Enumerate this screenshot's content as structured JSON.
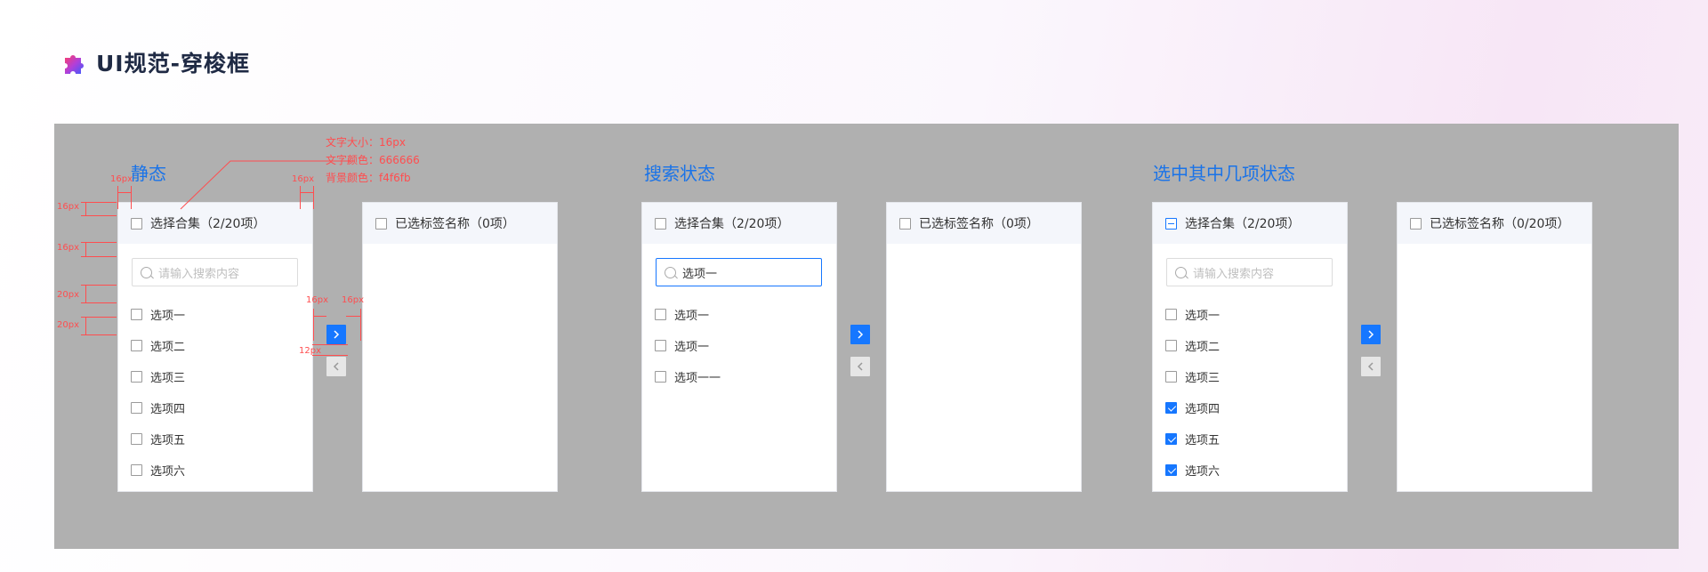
{
  "page": {
    "title": "UI规范-穿梭框",
    "logo_icon": "puzzle-icon",
    "accent_color": "#1677ff",
    "annotation_color": "#ff4d4f"
  },
  "sections": [
    {
      "title": "静态",
      "source": {
        "header": "选择合集（2/20项）",
        "header_state": "unchecked",
        "search_value": "",
        "search_placeholder": "请输入搜索内容",
        "items": [
          {
            "label": "选项一",
            "checked": false
          },
          {
            "label": "选项二",
            "checked": false
          },
          {
            "label": "选项三",
            "checked": false
          },
          {
            "label": "选项四",
            "checked": false
          },
          {
            "label": "选项五",
            "checked": false
          },
          {
            "label": "选项六",
            "checked": false
          }
        ]
      },
      "target": {
        "header": "已选标签名称（0项）",
        "header_state": "unchecked"
      }
    },
    {
      "title": "搜索状态",
      "source": {
        "header": "选择合集（2/20项）",
        "header_state": "unchecked",
        "search_value": "选项一",
        "search_placeholder": "",
        "items": [
          {
            "label": "选项一",
            "checked": false
          },
          {
            "label": "选项一",
            "checked": false
          },
          {
            "label": "选项一一",
            "checked": false
          }
        ]
      },
      "target": {
        "header": "已选标签名称（0项）",
        "header_state": "unchecked"
      }
    },
    {
      "title": "选中其中几项状态",
      "source": {
        "header": "选择合集（2/20项）",
        "header_state": "indeterminate",
        "search_value": "",
        "search_placeholder": "请输入搜索内容",
        "items": [
          {
            "label": "选项一",
            "checked": false
          },
          {
            "label": "选项二",
            "checked": false
          },
          {
            "label": "选项三",
            "checked": false
          },
          {
            "label": "选项四",
            "checked": true
          },
          {
            "label": "选项五",
            "checked": true
          },
          {
            "label": "选项六",
            "checked": true
          }
        ]
      },
      "target": {
        "header": "已选标签名称（0/20项）",
        "header_state": "unchecked"
      }
    }
  ],
  "annotations": {
    "spec_font_size": "文字大小：16px",
    "spec_font_color": "文字颜色：666666",
    "spec_bg_color": "背景颜色：f4f6fb",
    "gap_16": "16px",
    "gap_20": "20px",
    "gap_12": "12px"
  }
}
